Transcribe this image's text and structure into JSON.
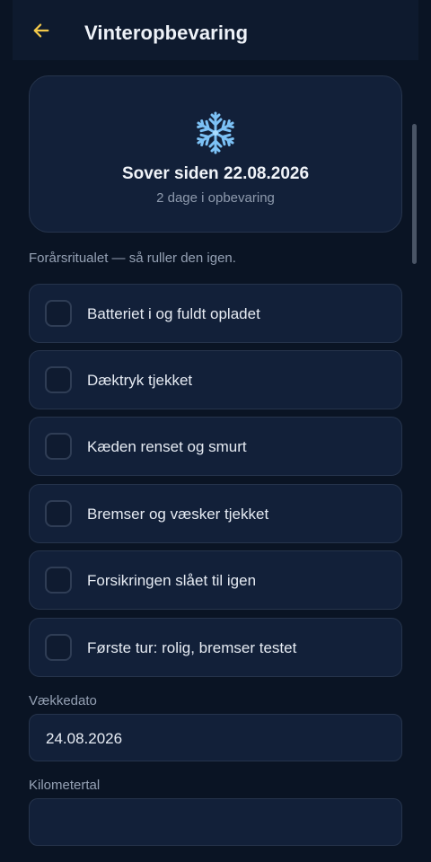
{
  "header": {
    "title": "Vinteropbevaring",
    "back_icon": "arrow-left-icon",
    "accent_color": "#f3c94a"
  },
  "hero": {
    "icon": "snowflake-icon",
    "title": "Sover siden 22.08.2026",
    "subtitle": "2 dage i opbevaring"
  },
  "checklist": {
    "intro": "Forårsritualet — så ruller den igen.",
    "items": [
      {
        "label": "Batteriet i og fuldt opladet",
        "checked": false
      },
      {
        "label": "Dæktryk tjekket",
        "checked": false
      },
      {
        "label": "Kæden renset og smurt",
        "checked": false
      },
      {
        "label": "Bremser og væsker tjekket",
        "checked": false
      },
      {
        "label": "Forsikringen slået til igen",
        "checked": false
      },
      {
        "label": "Første tur: rolig, bremser testet",
        "checked": false
      }
    ]
  },
  "form": {
    "wake_date": {
      "label": "Vækkedato",
      "value": "24.08.2026"
    },
    "mileage": {
      "label": "Kilometertal",
      "value": ""
    }
  }
}
